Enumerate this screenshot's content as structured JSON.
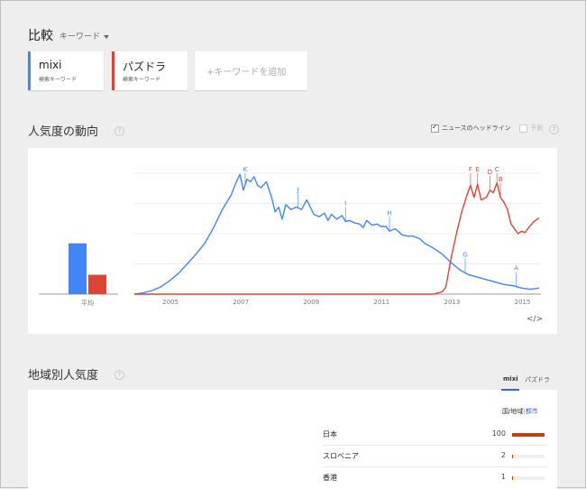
{
  "header": {
    "title": "比較",
    "keyword_dropdown": "キーワード"
  },
  "terms": [
    {
      "name": "mixi",
      "sub": "検索キーワード",
      "color": "#4285f4"
    },
    {
      "name": "パズドラ",
      "sub": "検索キーワード",
      "color": "#db4437"
    }
  ],
  "add_term_label": "+キーワードを追加",
  "trend": {
    "title": "人気度の動向",
    "help": "?",
    "news_headlines": "ニュースのヘッドライン",
    "forecast": "予測",
    "average_label": "平均",
    "embed": "</>"
  },
  "region": {
    "title": "地域別人気度",
    "help": "?",
    "tabs": [
      "mixi",
      "パズドラ"
    ],
    "view_country": "国/地域",
    "view_sep": "|",
    "view_city": "都市",
    "rows": [
      {
        "name": "日本",
        "value": 100
      },
      {
        "name": "スロベニア",
        "value": 2
      },
      {
        "name": "香港",
        "value": 1
      }
    ]
  },
  "chart_data": {
    "type": "line",
    "x_ticks": [
      "2005",
      "2007",
      "2009",
      "2011",
      "2013",
      "2015"
    ],
    "ylim": [
      0,
      100
    ],
    "grid": true,
    "average_bars": [
      {
        "series": "mixi",
        "value": 42
      },
      {
        "series": "パズドラ",
        "value": 16
      }
    ],
    "series": [
      {
        "name": "mixi",
        "color": "#4285f4",
        "points": [
          [
            2004.0,
            0
          ],
          [
            2004.25,
            1
          ],
          [
            2004.5,
            3
          ],
          [
            2004.75,
            6
          ],
          [
            2005.0,
            11
          ],
          [
            2005.25,
            17
          ],
          [
            2005.5,
            25
          ],
          [
            2005.75,
            33
          ],
          [
            2006.0,
            42
          ],
          [
            2006.25,
            55
          ],
          [
            2006.5,
            70
          ],
          [
            2006.75,
            82
          ],
          [
            2006.9,
            93
          ],
          [
            2007.0,
            99
          ],
          [
            2007.1,
            86
          ],
          [
            2007.2,
            95
          ],
          [
            2007.3,
            93
          ],
          [
            2007.4,
            97
          ],
          [
            2007.5,
            90
          ],
          [
            2007.6,
            88
          ],
          [
            2007.75,
            93
          ],
          [
            2007.9,
            80
          ],
          [
            2008.0,
            68
          ],
          [
            2008.1,
            72
          ],
          [
            2008.2,
            62
          ],
          [
            2008.3,
            74
          ],
          [
            2008.45,
            70
          ],
          [
            2008.6,
            72
          ],
          [
            2008.75,
            70
          ],
          [
            2008.9,
            78
          ],
          [
            2009.0,
            72
          ],
          [
            2009.1,
            66
          ],
          [
            2009.25,
            64
          ],
          [
            2009.4,
            67
          ],
          [
            2009.5,
            61
          ],
          [
            2009.6,
            66
          ],
          [
            2009.75,
            62
          ],
          [
            2009.9,
            65
          ],
          [
            2010.0,
            60
          ],
          [
            2010.1,
            61
          ],
          [
            2010.25,
            59
          ],
          [
            2010.4,
            58
          ],
          [
            2010.5,
            55
          ],
          [
            2010.6,
            61
          ],
          [
            2010.75,
            57
          ],
          [
            2010.9,
            58
          ],
          [
            2011.0,
            56
          ],
          [
            2011.15,
            56
          ],
          [
            2011.25,
            52
          ],
          [
            2011.4,
            54
          ],
          [
            2011.5,
            52
          ],
          [
            2011.6,
            49
          ],
          [
            2011.75,
            48
          ],
          [
            2011.9,
            48
          ],
          [
            2012.1,
            46
          ],
          [
            2012.25,
            42
          ],
          [
            2012.5,
            38
          ],
          [
            2012.75,
            33
          ],
          [
            2013.0,
            26
          ],
          [
            2013.25,
            20
          ],
          [
            2013.5,
            16
          ],
          [
            2013.75,
            14
          ],
          [
            2014.0,
            12
          ],
          [
            2014.25,
            10
          ],
          [
            2014.5,
            8
          ],
          [
            2014.75,
            7
          ],
          [
            2015.0,
            5
          ],
          [
            2015.25,
            4
          ],
          [
            2015.5,
            5
          ]
        ]
      },
      {
        "name": "パズドラ",
        "color": "#db4437",
        "points": [
          [
            2004.0,
            0
          ],
          [
            2012.5,
            0
          ],
          [
            2012.75,
            2
          ],
          [
            2012.85,
            6
          ],
          [
            2013.0,
            30
          ],
          [
            2013.15,
            50
          ],
          [
            2013.3,
            68
          ],
          [
            2013.45,
            82
          ],
          [
            2013.55,
            90
          ],
          [
            2013.65,
            80
          ],
          [
            2013.75,
            91
          ],
          [
            2013.85,
            78
          ],
          [
            2014.0,
            80
          ],
          [
            2014.1,
            86
          ],
          [
            2014.2,
            84
          ],
          [
            2014.3,
            92
          ],
          [
            2014.4,
            80
          ],
          [
            2014.5,
            76
          ],
          [
            2014.6,
            70
          ],
          [
            2014.7,
            58
          ],
          [
            2014.8,
            54
          ],
          [
            2014.9,
            50
          ],
          [
            2015.0,
            52
          ],
          [
            2015.1,
            51
          ],
          [
            2015.2,
            55
          ],
          [
            2015.35,
            60
          ],
          [
            2015.5,
            63
          ]
        ]
      }
    ],
    "annotations": [
      {
        "letter": "K",
        "x": 2007.15,
        "series": "mixi"
      },
      {
        "letter": "J",
        "x": 2008.65,
        "series": "mixi"
      },
      {
        "letter": "I",
        "x": 2010.0,
        "series": "mixi"
      },
      {
        "letter": "H",
        "x": 2011.25,
        "series": "mixi"
      },
      {
        "letter": "G",
        "x": 2013.4,
        "series": "mixi"
      },
      {
        "letter": "A",
        "x": 2014.85,
        "series": "mixi"
      },
      {
        "letter": "F",
        "x": 2013.55,
        "series": "パズドラ"
      },
      {
        "letter": "E",
        "x": 2013.75,
        "series": "パズドラ"
      },
      {
        "letter": "D",
        "x": 2014.1,
        "series": "パズドラ"
      },
      {
        "letter": "C",
        "x": 2014.3,
        "series": "パズドラ"
      },
      {
        "letter": "B",
        "x": 2014.4,
        "series": "パズドラ"
      }
    ]
  }
}
